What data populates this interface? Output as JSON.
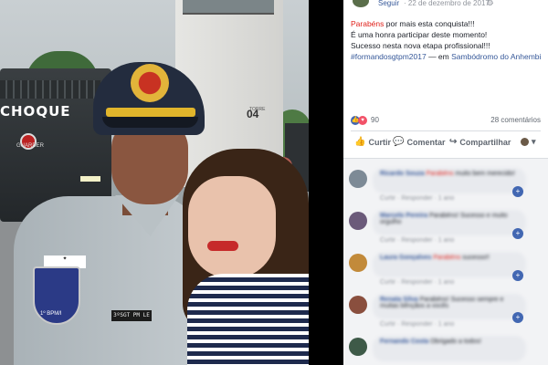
{
  "photo": {
    "truck_label": "CHOQUE",
    "truck_sub": "GUARDER",
    "tower_text": "04",
    "tower_small": "TORRE",
    "patch_top": "✦",
    "patch_text": "1º BPM/I",
    "nameplate": "3ºSGT PM LE"
  },
  "header": {
    "follow": "Seguir",
    "date": "· 22 de dezembro de 2017 ·",
    "globe_icon": "globe-icon"
  },
  "post": {
    "line1_red": "Parabéns",
    "line1_rest": " por mais esta conquista!!!",
    "line2": "É uma honra participar deste momento!",
    "line3": "Sucesso nesta nova etapa profissional!!!",
    "hashtag": "#formandosgtpm2017",
    "location_prefix": " — em ",
    "location": "Sambódromo do Anhembi"
  },
  "reactions": {
    "like_icon": "👍",
    "love_icon": "♥",
    "count": "90",
    "comments": "28 comentários"
  },
  "actions": {
    "like": "Curtir",
    "comment": "Comentar",
    "share": "Compartilhar",
    "like_icon": "👍",
    "comment_icon": "💬",
    "share_icon": "↪",
    "dropdown_icon": "▾"
  },
  "comments": [
    {
      "name": "Ricardo Souza",
      "highlight": "Parabéns",
      "text": " muito bem merecido! ",
      "meta": "Curtir · Responder · 1 ano",
      "color": "#7d8a96"
    },
    {
      "name": "Marcelo Pereira",
      "highlight": "",
      "text": " Parabéns! Sucesso e muito orgulho",
      "meta": "Curtir · Responder · 1 ano",
      "color": "#6b5a7a"
    },
    {
      "name": "Laura Gonçalves",
      "highlight": "Parabéns",
      "text": " sucesso!!",
      "meta": "Curtir · Responder · 1 ano",
      "color": "#c28a3a"
    },
    {
      "name": "Renata Silva",
      "highlight": "",
      "text": " Parabéns! Sucesso sempre e muitas bênçãos a vocês",
      "meta": "Curtir · Responder · 1 ano",
      "color": "#8a4f3e"
    },
    {
      "name": "Fernando Costa",
      "highlight": "",
      "text": " Obrigado a todos!",
      "meta": "",
      "color": "#3e5a48"
    }
  ]
}
